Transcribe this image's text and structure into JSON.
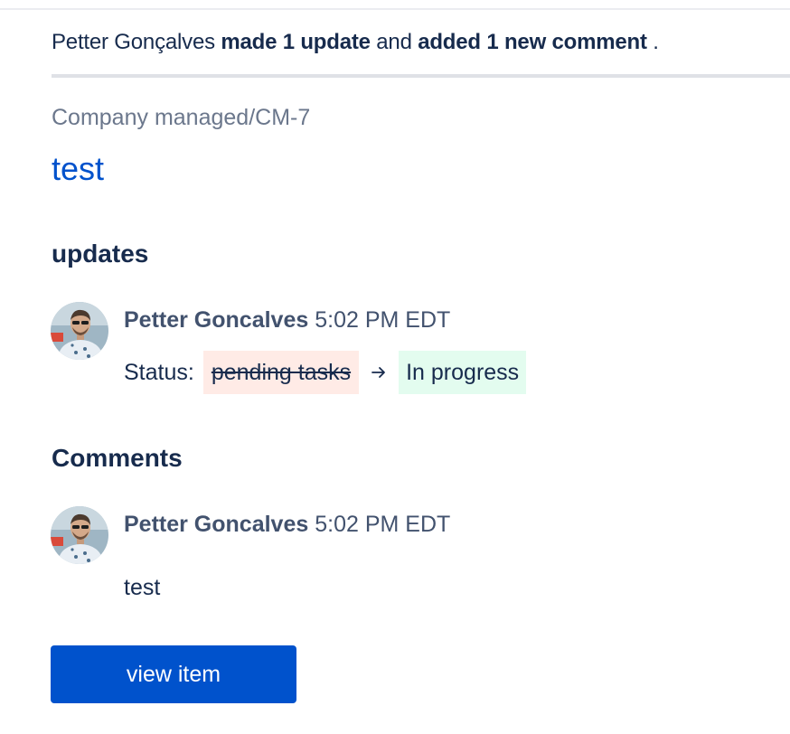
{
  "summary": {
    "author": "Petter Gonçalves",
    "action_1": "made 1 update",
    "connector": "and",
    "action_2": "added 1 new comment",
    "end": "."
  },
  "issue": {
    "breadcrumb": "Company managed/CM-7",
    "title": "test"
  },
  "updates": {
    "heading": "updates",
    "items": [
      {
        "author": "Petter Goncalves",
        "time": "5:02 PM EDT",
        "field_label": "Status:",
        "old_value": "pending tasks",
        "new_value": "In progress",
        "arrow_icon": "arrow-right-icon",
        "avatar_icon": "avatar-photo"
      }
    ]
  },
  "comments": {
    "heading": "Comments",
    "items": [
      {
        "author": "Petter Goncalves",
        "time": "5:02 PM EDT",
        "body": "test",
        "avatar_icon": "avatar-photo"
      }
    ]
  },
  "actions": {
    "view_item_label": "view item"
  },
  "colors": {
    "link": "#0052cc",
    "text": "#172b4d",
    "muted": "#6b778c",
    "removed_bg": "#ffebe6",
    "added_bg": "#e3fcef",
    "button_bg": "#0052cc"
  }
}
